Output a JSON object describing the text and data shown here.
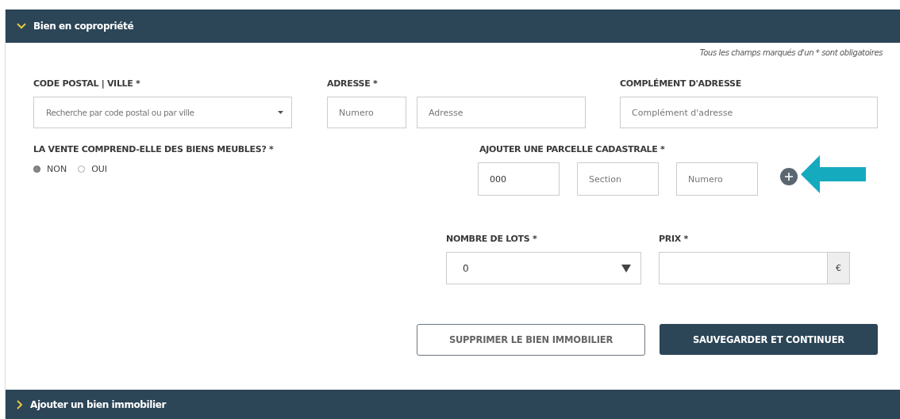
{
  "sections": [
    {
      "title": "Bien en copropriété",
      "expanded": true
    },
    {
      "title": "Ajouter un bien immobilier",
      "expanded": false
    }
  ],
  "required_note": "Tous les champs marqués d'un * sont obligatoires",
  "row1": [
    {
      "label": "CODE POSTAL | VILLE *",
      "inputs": [
        {
          "kind": "select",
          "placeholder": "Recherche par code postal ou par ville"
        }
      ]
    },
    {
      "label": "ADRESSE *",
      "inputs": [
        {
          "kind": "text",
          "placeholder": "Numero"
        },
        {
          "kind": "text",
          "placeholder": "Adresse"
        }
      ]
    },
    {
      "label": "COMPLÉMENT D'ADRESSE",
      "inputs": [
        {
          "kind": "text",
          "placeholder": "Complément d'adresse"
        }
      ]
    }
  ],
  "furniture": {
    "label": "LA VENTE COMPREND-ELLE DES BIENS MEUBLES? *",
    "options": [
      {
        "label": "NON",
        "selected": true
      },
      {
        "label": "OUI",
        "selected": false
      }
    ]
  },
  "parcel": {
    "label": "AJOUTER UNE PARCELLE CADASTRALE *",
    "inputs": [
      {
        "value": "000"
      },
      {
        "placeholder": "Section"
      },
      {
        "placeholder": "Numero"
      }
    ]
  },
  "lots": {
    "label": "NOMBRE DE LOTS *",
    "value": "0"
  },
  "price": {
    "label": "PRIX *",
    "addon": "€"
  },
  "buttons": [
    {
      "kind": "secondary",
      "label": "SUPPRIMER LE BIEN IMMOBILIER"
    },
    {
      "kind": "primary",
      "label": "SAUVEGARDER ET CONTINUER"
    }
  ]
}
